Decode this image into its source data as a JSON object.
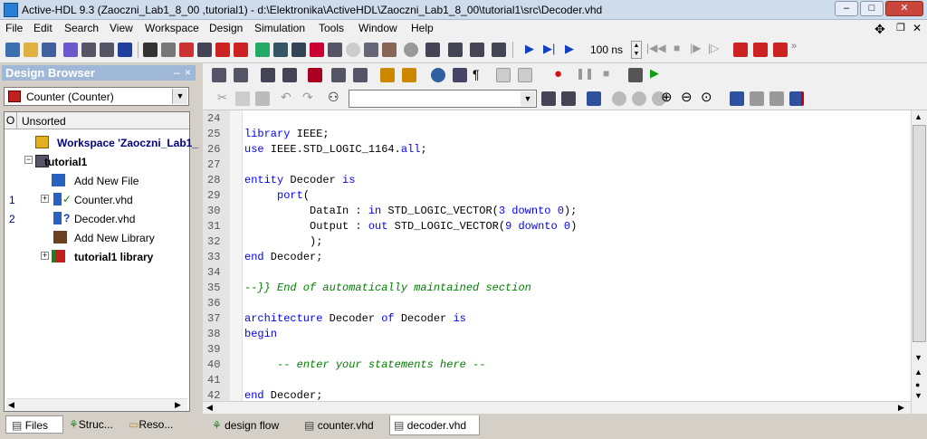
{
  "window": {
    "title": "Active-HDL 9.3 (Zaoczni_Lab1_8_00 ,tutorial1) - d:\\Elektronika\\ActiveHDL\\Zaoczni_Lab1_8_00\\tutorial1\\src\\Decoder.vhd",
    "minimize": "–",
    "maximize": "□",
    "close": "✕"
  },
  "menu": [
    "File",
    "Edit",
    "Search",
    "View",
    "Workspace",
    "Design",
    "Simulation",
    "Tools",
    "Window",
    "Help"
  ],
  "toolbar": {
    "sim_time": "100 ns"
  },
  "design_browser": {
    "title": "Design Browser",
    "close": "×",
    "pin": "–",
    "design_select": "Counter (Counter)",
    "col_o": "O",
    "col_sort": "Unsorted",
    "tree": {
      "workspace": "Workspace 'Zaoczni_Lab1_",
      "design": "tutorial1",
      "add_new_file": "Add New File",
      "counter_num": "1",
      "counter_file": "Counter.vhd",
      "decoder_num": "2",
      "decoder_file": "Decoder.vhd",
      "add_new_library": "Add New Library",
      "library": "tutorial1 library"
    },
    "tabs": [
      "Files",
      "Struc...",
      "Reso..."
    ]
  },
  "editor": {
    "lines": [
      {
        "n": "24",
        "html": ""
      },
      {
        "n": "25",
        "html": "<span class=\"kw\">library</span> IEEE;"
      },
      {
        "n": "26",
        "html": "<span class=\"kw\">use</span> IEEE.STD_LOGIC_1164.<span class=\"kw\">all</span>;"
      },
      {
        "n": "27",
        "html": ""
      },
      {
        "n": "28",
        "html": "<span class=\"kw\">entity</span> Decoder <span class=\"kw\">is</span>"
      },
      {
        "n": "29",
        "html": "     <span class=\"kw\">port</span>("
      },
      {
        "n": "30",
        "html": "          DataIn : <span class=\"kw\">in</span> STD_LOGIC_VECTOR(<span class=\"kw\">3</span> <span class=\"kw\">downto</span> <span class=\"kw\">0</span>);"
      },
      {
        "n": "31",
        "html": "          Output : <span class=\"kw\">out</span> STD_LOGIC_VECTOR(<span class=\"kw\">9</span> <span class=\"kw\">downto</span> <span class=\"kw\">0</span>)"
      },
      {
        "n": "32",
        "html": "          );"
      },
      {
        "n": "33",
        "html": "<span class=\"kw\">end</span> Decoder;"
      },
      {
        "n": "34",
        "html": ""
      },
      {
        "n": "35",
        "html": "<span class=\"cm\">--}} End of automatically maintained section</span>"
      },
      {
        "n": "36",
        "html": ""
      },
      {
        "n": "37",
        "html": "<span class=\"kw\">architecture</span> Decoder <span class=\"kw\">of</span> Decoder <span class=\"kw\">is</span>"
      },
      {
        "n": "38",
        "html": "<span class=\"kw\">begin</span>"
      },
      {
        "n": "39",
        "html": ""
      },
      {
        "n": "40",
        "html": "     <span class=\"cm\">-- enter your statements here --</span>"
      },
      {
        "n": "41",
        "html": ""
      },
      {
        "n": "42",
        "html": "<span class=\"kw\">end</span> Decoder;"
      }
    ],
    "tabs": [
      "design flow",
      "counter.vhd",
      "decoder.vhd"
    ],
    "active_tab": "decoder.vhd"
  }
}
